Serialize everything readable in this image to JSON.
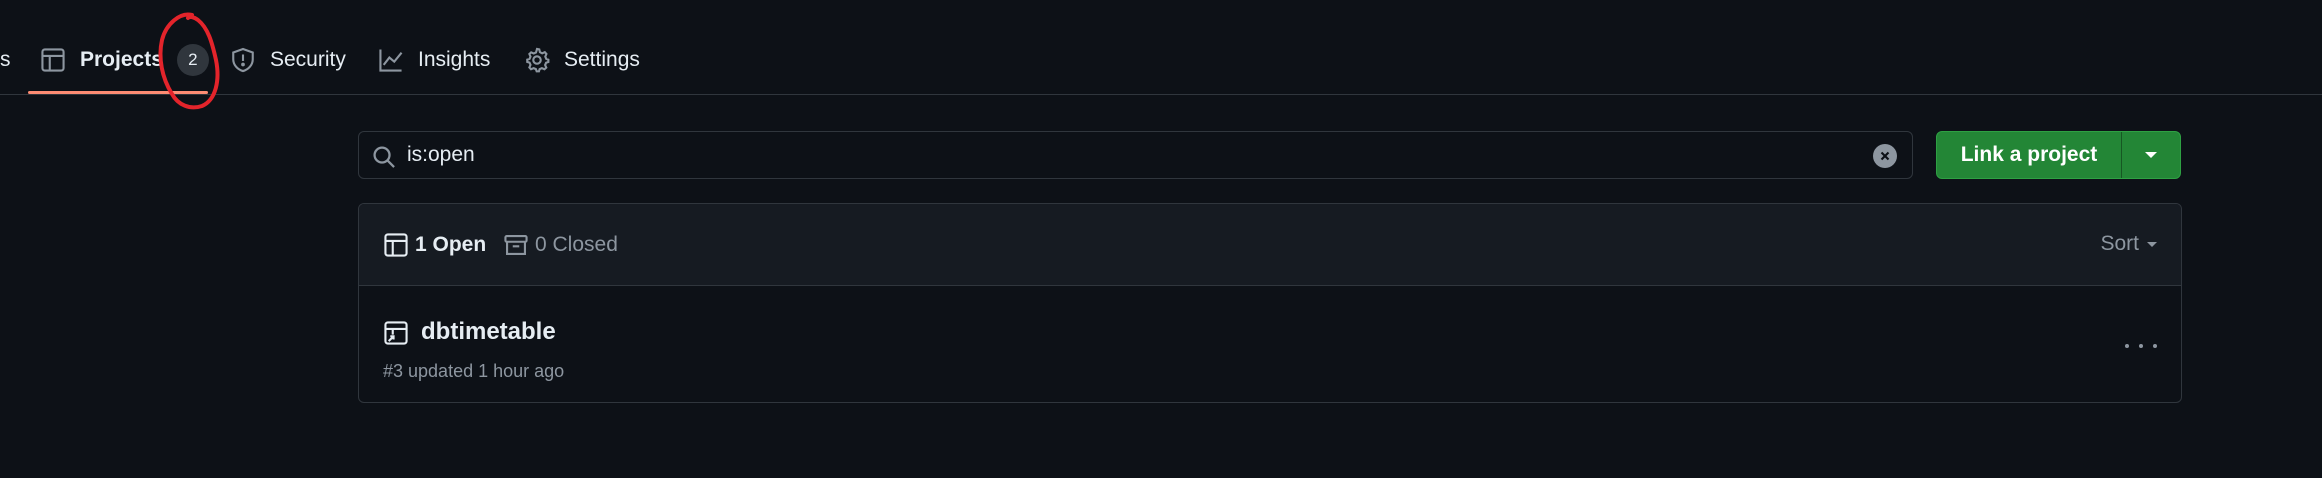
{
  "repo_nav": {
    "cut_label": "s",
    "items": [
      {
        "label": "Projects",
        "icon": "table-icon",
        "active": true,
        "counter": "2"
      },
      {
        "label": "Security",
        "icon": "shield-icon"
      },
      {
        "label": "Insights",
        "icon": "graph-icon"
      },
      {
        "label": "Settings",
        "icon": "gear-icon"
      }
    ]
  },
  "search": {
    "value": "is:open"
  },
  "actions": {
    "link_project_label": "Link a project"
  },
  "projects_box": {
    "open_label": "1 Open",
    "closed_label": "0 Closed",
    "sort_label": "Sort",
    "rows": [
      {
        "title": "dbtimetable",
        "meta": "#3 updated 1 hour ago"
      }
    ]
  },
  "colors": {
    "background": "#0d1117",
    "border": "#30363d",
    "accent_underline": "#fd8c73",
    "primary_button": "#238636",
    "annotation": "#e3242b"
  }
}
